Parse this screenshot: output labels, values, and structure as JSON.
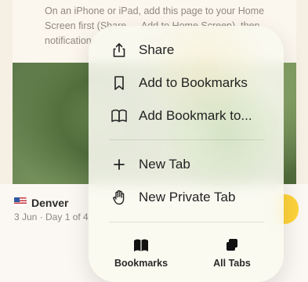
{
  "background": {
    "text": "On an iPhone or iPad, add this page to your Home Screen first (Share → Add to Home Screen), then notifications can be switched on",
    "city": "Denver",
    "meta": "3 Jun · Day 1 of 4"
  },
  "menu": {
    "items": [
      {
        "label": "Share",
        "icon": "share-icon"
      },
      {
        "label": "Add to Bookmarks",
        "icon": "bookmark-icon"
      },
      {
        "label": "Add Bookmark to...",
        "icon": "book-icon"
      },
      {
        "label": "New Tab",
        "icon": "plus-icon"
      },
      {
        "label": "New Private Tab",
        "icon": "hand-icon"
      }
    ],
    "bottom": [
      {
        "label": "Bookmarks",
        "icon": "book-open-icon"
      },
      {
        "label": "All Tabs",
        "icon": "tabs-icon"
      }
    ]
  },
  "colors": {
    "accent": "#ffd33a",
    "menu_bg": "#f9f9f0"
  }
}
